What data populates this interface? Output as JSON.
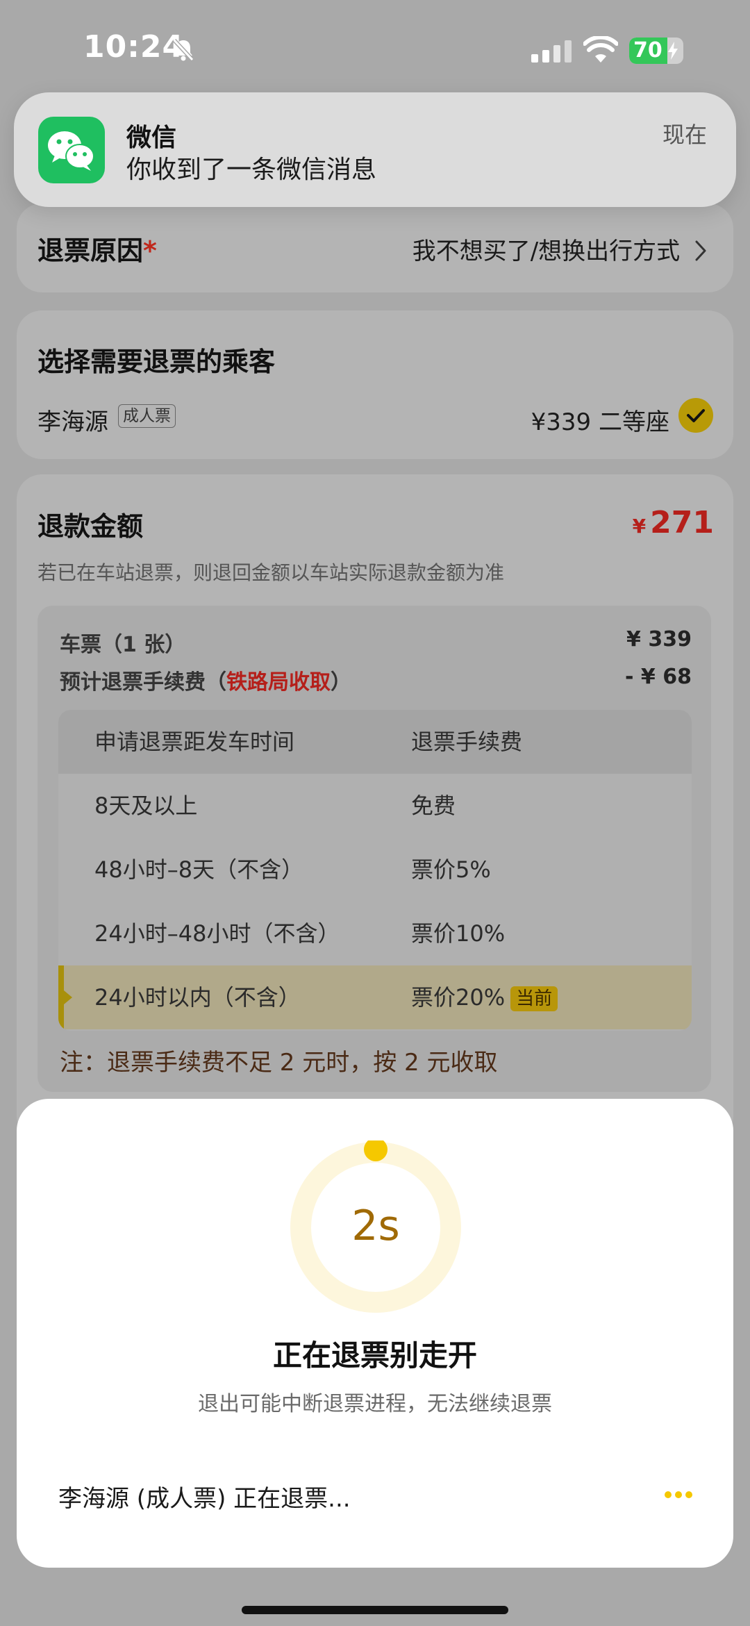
{
  "status_bar": {
    "time": "10:24",
    "battery_level": 70,
    "battery_text": "70"
  },
  "notification": {
    "app_name": "微信",
    "message": "你收到了一条微信消息",
    "time": "现在"
  },
  "refund_reason": {
    "label": "退票原因",
    "required_mark": "*",
    "value": "我不想买了/想换出行方式"
  },
  "passenger_section": {
    "title": "选择需要退票的乘客",
    "passenger": {
      "name": "李海源",
      "ticket_type": "成人票",
      "price_seat": "¥339 二等座",
      "selected": true
    }
  },
  "refund_amount": {
    "title": "退款金额",
    "currency": "¥",
    "amount": "271",
    "note": "若已在车站退票，则退回金额以车站实际退款金额为准",
    "ticket_label": "车票（1 张）",
    "ticket_value": "¥ 339",
    "fee_label_prefix": "预计退票手续费（",
    "fee_label_red": "铁路局收取",
    "fee_label_suffix": "）",
    "fee_value": "- ¥ 68"
  },
  "fee_table": {
    "headers": [
      "申请退票距发车时间",
      "退票手续费"
    ],
    "rows": [
      {
        "time": "8天及以上",
        "fee": "免费"
      },
      {
        "time": "48小时–8天（不含）",
        "fee": "票价5%"
      },
      {
        "time": "24小时–48小时（不含）",
        "fee": "票价10%"
      },
      {
        "time": "24小时以内（不含）",
        "fee": "票价20%",
        "current_tag": "当前"
      }
    ],
    "footnote": "注：退票手续费不足 2 元时，按 2 元收取"
  },
  "progress_sheet": {
    "countdown": "2s",
    "title": "正在退票别走开",
    "subtitle": "退出可能中断退票进程，无法继续退票",
    "status_text": "李海源 (成人票) 正在退票..."
  },
  "colors": {
    "accent_red": "#c0271b",
    "accent_gold": "#f5c800",
    "wechat_green": "#1fbf60"
  },
  "icons": [
    "bell-slash-icon",
    "signal-icon",
    "wifi-icon",
    "battery-icon",
    "wechat-icon",
    "chevron-right-icon",
    "check-circle-icon",
    "loading-dots-icon"
  ]
}
